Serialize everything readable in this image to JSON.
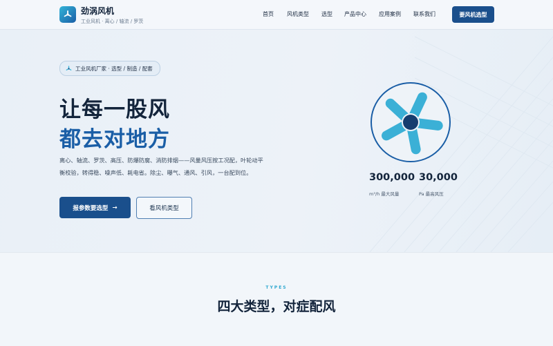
{
  "header": {
    "brand_name": "劲涡风机",
    "brand_tagline": "工业风机 · 离心 / 轴流 / 罗茨",
    "nav": [
      "首页",
      "风机类型",
      "选型",
      "产品中心",
      "应用案例",
      "联系我们"
    ],
    "cta": "要风机选型"
  },
  "hero": {
    "badge": "工业风机厂家 · 选型 / 制造 / 配套",
    "title_line1": "让每一股风",
    "title_line2": "都去对地方",
    "description": "离心、轴流、罗茨、高压、防爆防腐、消防排烟——风量风压按工况配，叶轮动平衡校验，转得稳、噪声低、耗电省。除尘、曝气、通风、引风，一台配到位。",
    "primary_button": "报参数要选型",
    "primary_button_arrow": "→",
    "secondary_button": "看风机类型",
    "stats": [
      {
        "value": "300,000",
        "label": "m³/h 最大风量"
      },
      {
        "value": "30,000",
        "label": "Pa 最高风压"
      }
    ]
  },
  "types_section": {
    "eyebrow": "TYPES",
    "title": "四大类型，对症配风"
  },
  "colors": {
    "primary": "#1a4f8c",
    "accent": "#1a5ea6",
    "teal": "#33b5d8"
  }
}
